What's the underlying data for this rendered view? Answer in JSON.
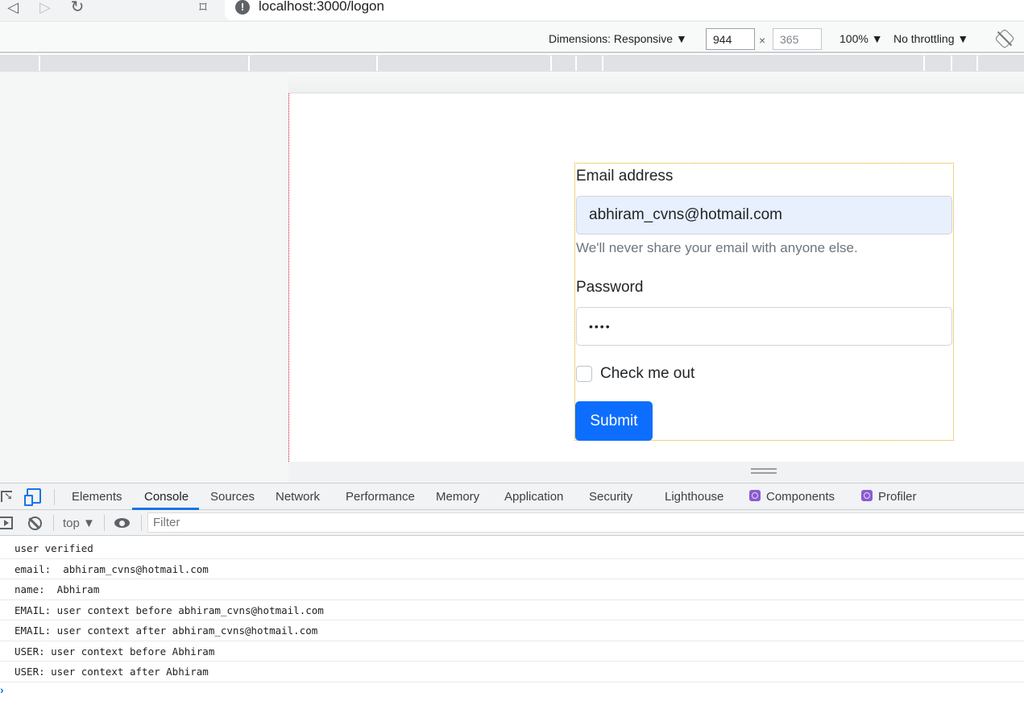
{
  "browser": {
    "url": "localhost:3000/logon",
    "icons": {
      "back": "back-arrow-icon",
      "forward": "forward-arrow-icon",
      "reload": "reload-icon",
      "bookmark": "bookmark-icon",
      "site_info": "info-icon"
    }
  },
  "device_toolbar": {
    "dimensions_label": "Dimensions: Responsive ▼",
    "width": "944",
    "height": "365",
    "times": "×",
    "zoom": "100% ▼",
    "throttling": "No throttling ▼"
  },
  "form": {
    "email_label": "Email address",
    "email_value": "abhiram_cvns@hotmail.com",
    "email_help": "We'll never share your email with anyone else.",
    "password_label": "Password",
    "password_value": "••••",
    "checkbox_label": "Check me out",
    "checkbox_checked": false,
    "submit_label": "Submit",
    "submit_color": "#0d6efd"
  },
  "devtools": {
    "tabs": [
      {
        "label": "Elements"
      },
      {
        "label": "Console",
        "active": true
      },
      {
        "label": "Sources"
      },
      {
        "label": "Network"
      },
      {
        "label": "Performance"
      },
      {
        "label": "Memory"
      },
      {
        "label": "Application"
      },
      {
        "label": "Security"
      },
      {
        "label": "Lighthouse"
      },
      {
        "label": "Components"
      },
      {
        "label": "Profiler"
      }
    ],
    "context": "top ▼",
    "filter_placeholder": "Filter",
    "accent": "#1a73e8"
  },
  "console": {
    "messages": [
      "user verified",
      "email:  abhiram_cvns@hotmail.com",
      "name:  Abhiram",
      "EMAIL: user context before abhiram_cvns@hotmail.com",
      "EMAIL: user context after abhiram_cvns@hotmail.com",
      "USER: user context before Abhiram",
      "USER: user context after Abhiram"
    ],
    "prompt": "›"
  }
}
